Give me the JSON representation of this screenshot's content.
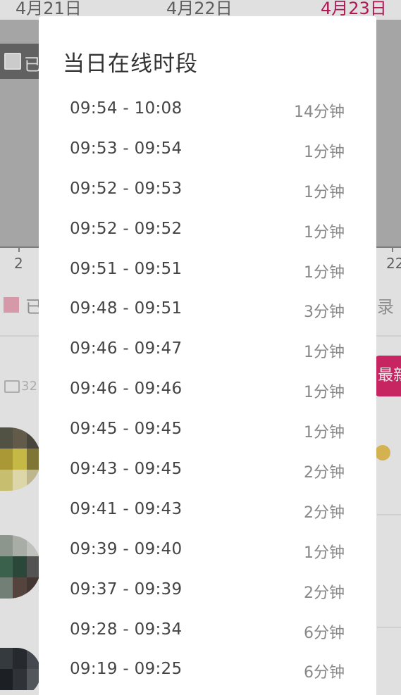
{
  "background": {
    "dates": [
      "4月21日",
      "4月22日",
      "4月23日"
    ],
    "axis_labels": [
      "2",
      "22"
    ],
    "legend_a_text": "已",
    "legend_b_text": "已",
    "link_right_text": "录",
    "comment_count": "32",
    "new_button_label": "最新"
  },
  "dialog": {
    "title": "当日在线时段",
    "sessions": [
      {
        "range": "09:54 - 10:08",
        "duration": "14分钟"
      },
      {
        "range": "09:53 - 09:54",
        "duration": "1分钟"
      },
      {
        "range": "09:52 - 09:53",
        "duration": "1分钟"
      },
      {
        "range": "09:52 - 09:52",
        "duration": "1分钟"
      },
      {
        "range": "09:51 - 09:51",
        "duration": "1分钟"
      },
      {
        "range": "09:48 - 09:51",
        "duration": "3分钟"
      },
      {
        "range": "09:46 - 09:47",
        "duration": "1分钟"
      },
      {
        "range": "09:46 - 09:46",
        "duration": "1分钟"
      },
      {
        "range": "09:45 - 09:45",
        "duration": "1分钟"
      },
      {
        "range": "09:43 - 09:45",
        "duration": "2分钟"
      },
      {
        "range": "09:41 - 09:43",
        "duration": "2分钟"
      },
      {
        "range": "09:39 - 09:40",
        "duration": "1分钟"
      },
      {
        "range": "09:37 - 09:39",
        "duration": "2分钟"
      },
      {
        "range": "09:28 - 09:34",
        "duration": "6分钟"
      },
      {
        "range": "09:19 - 09:25",
        "duration": "6分钟"
      }
    ]
  },
  "colors": {
    "accent": "#d8286b",
    "dialog_bg": "#ffffff",
    "overlay_area": "#b3b3b3"
  }
}
